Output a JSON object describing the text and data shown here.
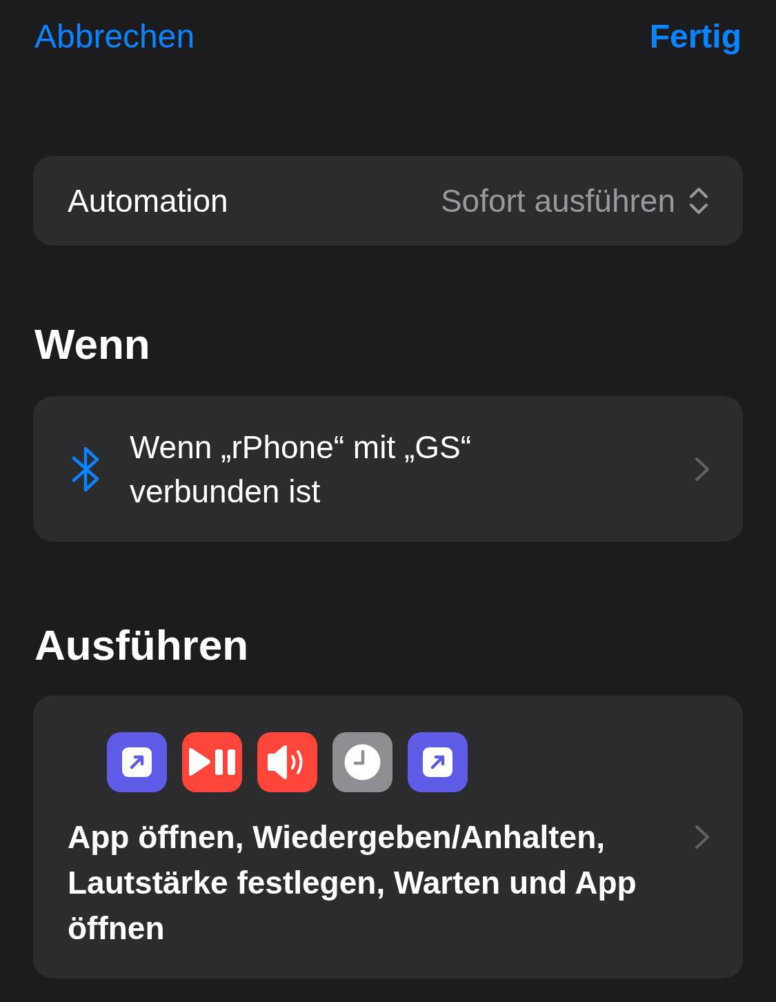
{
  "nav": {
    "cancel": "Abbrechen",
    "done": "Fertig"
  },
  "automation": {
    "label": "Automation",
    "value": "Sofort ausführen"
  },
  "when": {
    "heading": "Wenn",
    "trigger": "Wenn „rPhone“ mit „GS“ verbunden ist"
  },
  "run": {
    "heading": "Ausführen",
    "actions": [
      {
        "kind": "open-app",
        "color": "#5e5ce6"
      },
      {
        "kind": "play-pause",
        "color": "#ff453a"
      },
      {
        "kind": "volume",
        "color": "#ff453a"
      },
      {
        "kind": "wait",
        "color": "#8e8e93"
      },
      {
        "kind": "open-app",
        "color": "#5e5ce6"
      }
    ],
    "summary": "App öffnen, Wiedergeben/Anhalten, Lautstärke festlegen, Warten und App öffnen"
  }
}
